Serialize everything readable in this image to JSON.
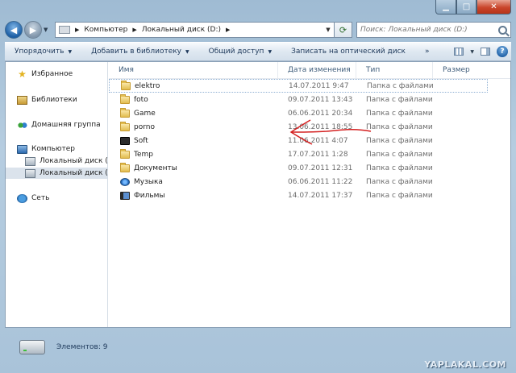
{
  "address": {
    "crumbs": [
      "Компьютер",
      "Локальный диск (D:)"
    ],
    "search_placeholder": "Поиск: Локальный диск (D:)"
  },
  "toolbar": {
    "organize": "Упорядочить",
    "add_library": "Добавить в библиотеку",
    "share": "Общий доступ",
    "burn": "Записать на оптический диск",
    "more": "»"
  },
  "nav": {
    "favorites": "Избранное",
    "libraries": "Библиотеки",
    "homegroup": "Домашняя группа",
    "computer": "Компьютер",
    "drive_c": "Локальный диск (C:)",
    "drive_d": "Локальный диск (D",
    "network": "Сеть"
  },
  "columns": {
    "name": "Имя",
    "date": "Дата изменения",
    "type": "Тип",
    "size": "Размер"
  },
  "files": [
    {
      "name": "elektro",
      "date": "14.07.2011 9:47",
      "type": "Папка с файлами",
      "icon": "folder-icon"
    },
    {
      "name": "foto",
      "date": "09.07.2011 13:43",
      "type": "Папка с файлами",
      "icon": "folder-icon"
    },
    {
      "name": "Game",
      "date": "06.06.2011 20:34",
      "type": "Папка с файлами",
      "icon": "folder-icon"
    },
    {
      "name": "porno",
      "date": "13.06.2011 18:55",
      "type": "Папка с файлами",
      "icon": "folder-icon"
    },
    {
      "name": "Soft",
      "date": "11.06.2011 4:07",
      "type": "Папка с файлами",
      "icon": "soft-folder-icon"
    },
    {
      "name": "Temp",
      "date": "17.07.2011 1:28",
      "type": "Папка с файлами",
      "icon": "folder-icon"
    },
    {
      "name": "Документы",
      "date": "09.07.2011 12:31",
      "type": "Папка с файлами",
      "icon": "folder-icon"
    },
    {
      "name": "Музыка",
      "date": "06.06.2011 11:22",
      "type": "Папка с файлами",
      "icon": "music-folder-icon"
    },
    {
      "name": "Фильмы",
      "date": "14.07.2011 17:37",
      "type": "Папка с файлами",
      "icon": "film-folder-icon"
    }
  ],
  "status": {
    "items_count": "Элементов: 9"
  },
  "watermark": "YAPLAKAL.COM",
  "colors": {
    "annotation_arrow": "#d42020",
    "window_frame": "#a9c3d9"
  }
}
